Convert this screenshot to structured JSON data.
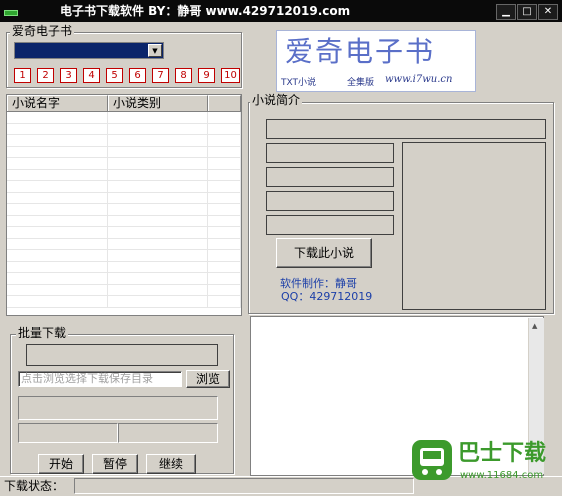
{
  "window": {
    "title": "电子书下载软件  BY：静哥   www.429712019.com",
    "minimize": "▁",
    "maximize": "□",
    "close": "✕"
  },
  "top_group": {
    "label": "爱奇电子书",
    "combo_value": "",
    "page_buttons": [
      "1",
      "2",
      "3",
      "4",
      "5",
      "6",
      "7",
      "8",
      "9",
      "10"
    ]
  },
  "logo": {
    "title": "爱奇电子书",
    "tag1": "TXT小说",
    "tag2": "全集版",
    "site": "www.i7wu.cn"
  },
  "novel_list": {
    "columns": [
      "小说名字",
      "小说类别"
    ],
    "rows": 17
  },
  "intro": {
    "label": "小说简介",
    "download_button": "下载此小说",
    "credit_line1": "软件制作：静哥",
    "credit_line2": "QQ：429712019"
  },
  "batch": {
    "label": "批量下载",
    "path_placeholder": "点击浏览选择下载保存目录",
    "browse_button": "浏览",
    "start_button": "开始",
    "pause_button": "暂停",
    "continue_button": "继续"
  },
  "status": {
    "label": "下载状态："
  },
  "watermark": {
    "brand": "巴士下载",
    "site": "www.11684.com"
  },
  "colors": {
    "accent_red": "#c00000",
    "credit_blue": "#1c3fa8",
    "watermark_green": "#3c9a2c"
  }
}
